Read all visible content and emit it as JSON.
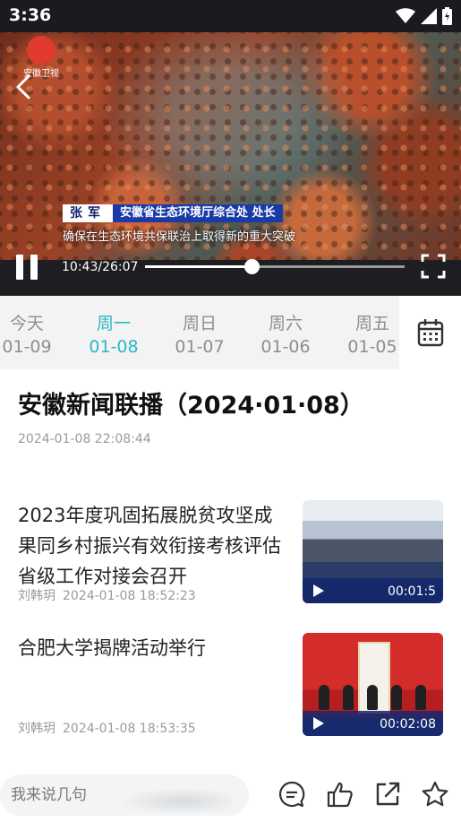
{
  "status_bar": {
    "time": "3:36"
  },
  "player": {
    "channel_logo_text": "安徽卫视",
    "caption": {
      "speaker_name": "张军",
      "speaker_title": "安徽省生态环境厅综合处 处长",
      "subtitle": "确保在生态环境共保联治上取得新的重大突破"
    },
    "current_time": "10:43",
    "total_time": "26:07",
    "timecode": "10:43/26:07",
    "progress": 0.41
  },
  "date_tabs": [
    {
      "day": "今天",
      "date": "01-09",
      "active": false
    },
    {
      "day": "周一",
      "date": "01-08",
      "active": true
    },
    {
      "day": "周日",
      "date": "01-07",
      "active": false
    },
    {
      "day": "周六",
      "date": "01-06",
      "active": false
    },
    {
      "day": "周五",
      "date": "01-05",
      "active": false
    }
  ],
  "program": {
    "title": "安徽新闻联播（2024·01·08）",
    "published": "2024-01-08 22:08:44"
  },
  "news": [
    {
      "title": "2023年度巩固拓展脱贫攻坚成果同乡村振兴有效衔接考核评估省级工作对接会召开",
      "author": "刘韩玥",
      "time": "2024-01-08 18:52:23",
      "duration": "00:01:5"
    },
    {
      "title": "合肥大学揭牌活动举行",
      "author": "刘韩玥",
      "time": "2024-01-08 18:53:35",
      "duration": "00:02:08"
    }
  ],
  "bottom_bar": {
    "comment_placeholder": "我来说几句"
  },
  "colors": {
    "accent": "#2bb7c4",
    "player_bg": "#1e1e22",
    "tab_bg": "#f3f3f3",
    "meta_gray": "#9a9a9a"
  },
  "icons": [
    "back-icon",
    "pause-icon",
    "fullscreen-icon",
    "calendar-icon",
    "comment-icon",
    "like-icon",
    "share-icon",
    "star-icon"
  ]
}
